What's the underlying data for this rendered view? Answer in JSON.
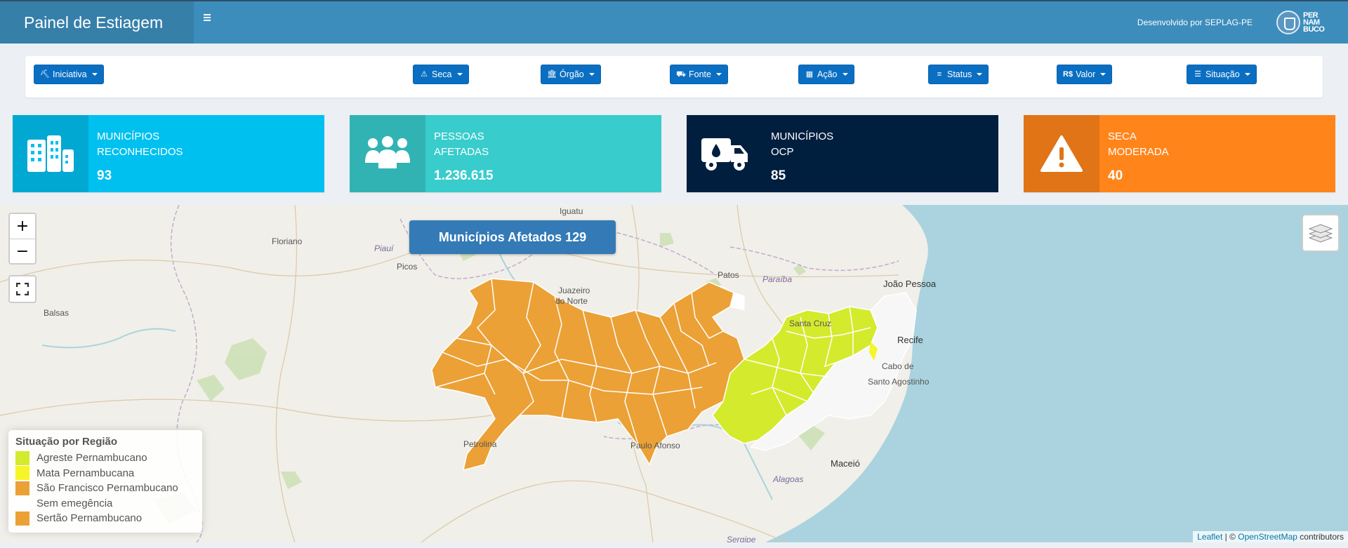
{
  "header": {
    "title": "Painel de Estiagem",
    "credit": "Desenvolvido por SEPLAG-PE",
    "logo_text_lines": [
      "PER",
      "NAM",
      "BUCO"
    ]
  },
  "filters": [
    {
      "label": "Iniciativa",
      "icon": "person-digging-icon"
    },
    {
      "label": "Seca",
      "icon": "warning-icon"
    },
    {
      "label": "Órgão",
      "icon": "institution-icon"
    },
    {
      "label": "Fonte",
      "icon": "truck-water-icon"
    },
    {
      "label": "Ação",
      "icon": "table-icon"
    },
    {
      "label": "Status",
      "icon": "bars-icon"
    },
    {
      "label": "Valor",
      "icon": "money-icon"
    },
    {
      "label": "Situação",
      "icon": "list-icon"
    }
  ],
  "filter_icon_glyphs": [
    "⛏",
    "⚠",
    "🏛",
    "⛟",
    "▦",
    "≡",
    "R$",
    "☰"
  ],
  "cards": [
    {
      "line1": "MUNICÍPIOS",
      "line2": "RECONHECIDOS",
      "value": "93",
      "icon": "city-icon",
      "color": "#00c0ef"
    },
    {
      "line1": "PESSOAS",
      "line2": "AFETADAS",
      "value": "1.236.615",
      "icon": "people-group-icon",
      "color": "#39cccc"
    },
    {
      "line1": "MUNICÍPIOS",
      "line2": "OCP",
      "value": "85",
      "icon": "water-truck-icon",
      "color": "#001f3f"
    },
    {
      "line1": "SECA",
      "line2": "MODERADA",
      "value": "40",
      "icon": "warning-triangle-icon",
      "color": "#ff851b"
    }
  ],
  "map": {
    "badge": "Municípios Afetados 129",
    "zoom_in": "+",
    "zoom_out": "−",
    "labels": {
      "iguatu": "Iguatu",
      "floriano": "Floriano",
      "piaui": "Piauí",
      "picos": "Picos",
      "juazeiro1": "Juazeiro",
      "juazeiro2": "do Norte",
      "patos": "Patos",
      "paraiba": "Paraíba",
      "joao_pessoa": "João Pessoa",
      "balsas": "Balsas",
      "santa_cruz": "Santa Cruz",
      "recife": "Recife",
      "cabo": "Cabo de",
      "santo_agostinho": "Santo Agostinho",
      "petrolina": "Petrolina",
      "paulo_afonso": "Paulo Afonso",
      "alagoas": "Alagoas",
      "maceio": "Maceió",
      "sergipe": "Sergipe"
    },
    "legend": {
      "title": "Situação por Região",
      "items": [
        {
          "label": "Agreste Pernambucano",
          "color": "#d4ea2d"
        },
        {
          "label": "Mata Pernambucana",
          "color": "#f5f52a"
        },
        {
          "label": "São Francisco Pernambucano",
          "color": "#eba136"
        },
        {
          "label": "Sem emegência",
          "color": "#ffffff"
        },
        {
          "label": "Sertão Pernambucano",
          "color": "#eba136"
        }
      ]
    },
    "attribution": {
      "leaflet": "Leaflet",
      "separator": " | © ",
      "osm": "OpenStreetMap",
      "suffix": " contributors"
    }
  },
  "colors": {
    "header": "#3c8dbc",
    "brand": "#367fa9",
    "button": "#0a6fc2",
    "sertao": "#eba136",
    "agreste": "#d4ea2d",
    "ocean": "#aad3df"
  }
}
